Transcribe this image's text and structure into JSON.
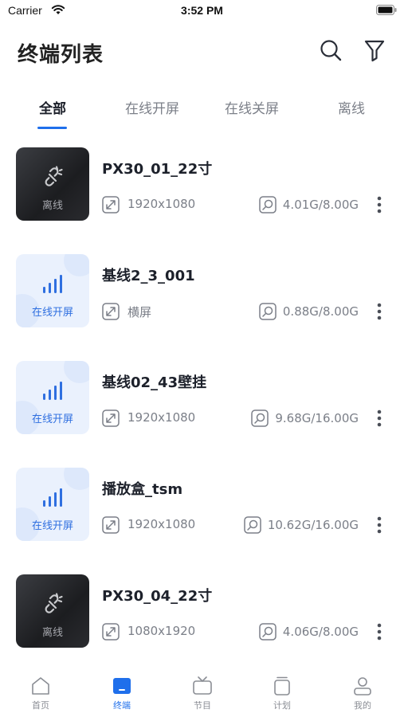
{
  "status_bar": {
    "carrier": "Carrier",
    "time": "3:52 PM"
  },
  "header": {
    "title": "终端列表",
    "search_icon": "search-icon",
    "filter_icon": "filter-icon"
  },
  "tabs": [
    {
      "label": "全部",
      "active": true
    },
    {
      "label": "在线开屏",
      "active": false
    },
    {
      "label": "在线关屏",
      "active": false
    },
    {
      "label": "离线",
      "active": false
    }
  ],
  "devices": [
    {
      "name": "PX30_01_22寸",
      "status": "离线",
      "status_type": "offline",
      "spec": "1920x1080",
      "storage": "4.01G/8.00G"
    },
    {
      "name": "基线2_3_001",
      "status": "在线开屏",
      "status_type": "online",
      "spec": "横屏",
      "storage": "0.88G/8.00G"
    },
    {
      "name": "基线02_43壁挂",
      "status": "在线开屏",
      "status_type": "online",
      "spec": "1920x1080",
      "storage": "9.68G/16.00G"
    },
    {
      "name": "播放盒_tsm",
      "status": "在线开屏",
      "status_type": "online",
      "spec": "1920x1080",
      "storage": "10.62G/16.00G"
    },
    {
      "name": "PX30_04_22寸",
      "status": "离线",
      "status_type": "offline",
      "spec": "1080x1920",
      "storage": "4.06G/8.00G"
    }
  ],
  "bottom_nav": [
    {
      "label": "首页",
      "icon": "home-icon",
      "active": false
    },
    {
      "label": "终端",
      "icon": "terminal-icon",
      "active": true
    },
    {
      "label": "节目",
      "icon": "tv-icon",
      "active": false
    },
    {
      "label": "计划",
      "icon": "plan-icon",
      "active": false
    },
    {
      "label": "我的",
      "icon": "profile-icon",
      "active": false
    }
  ],
  "colors": {
    "accent": "#1f6feb",
    "online_bg": "#eaf1fd",
    "offline_bg": "#2a2b2f",
    "text_secondary": "#7b7f88"
  }
}
